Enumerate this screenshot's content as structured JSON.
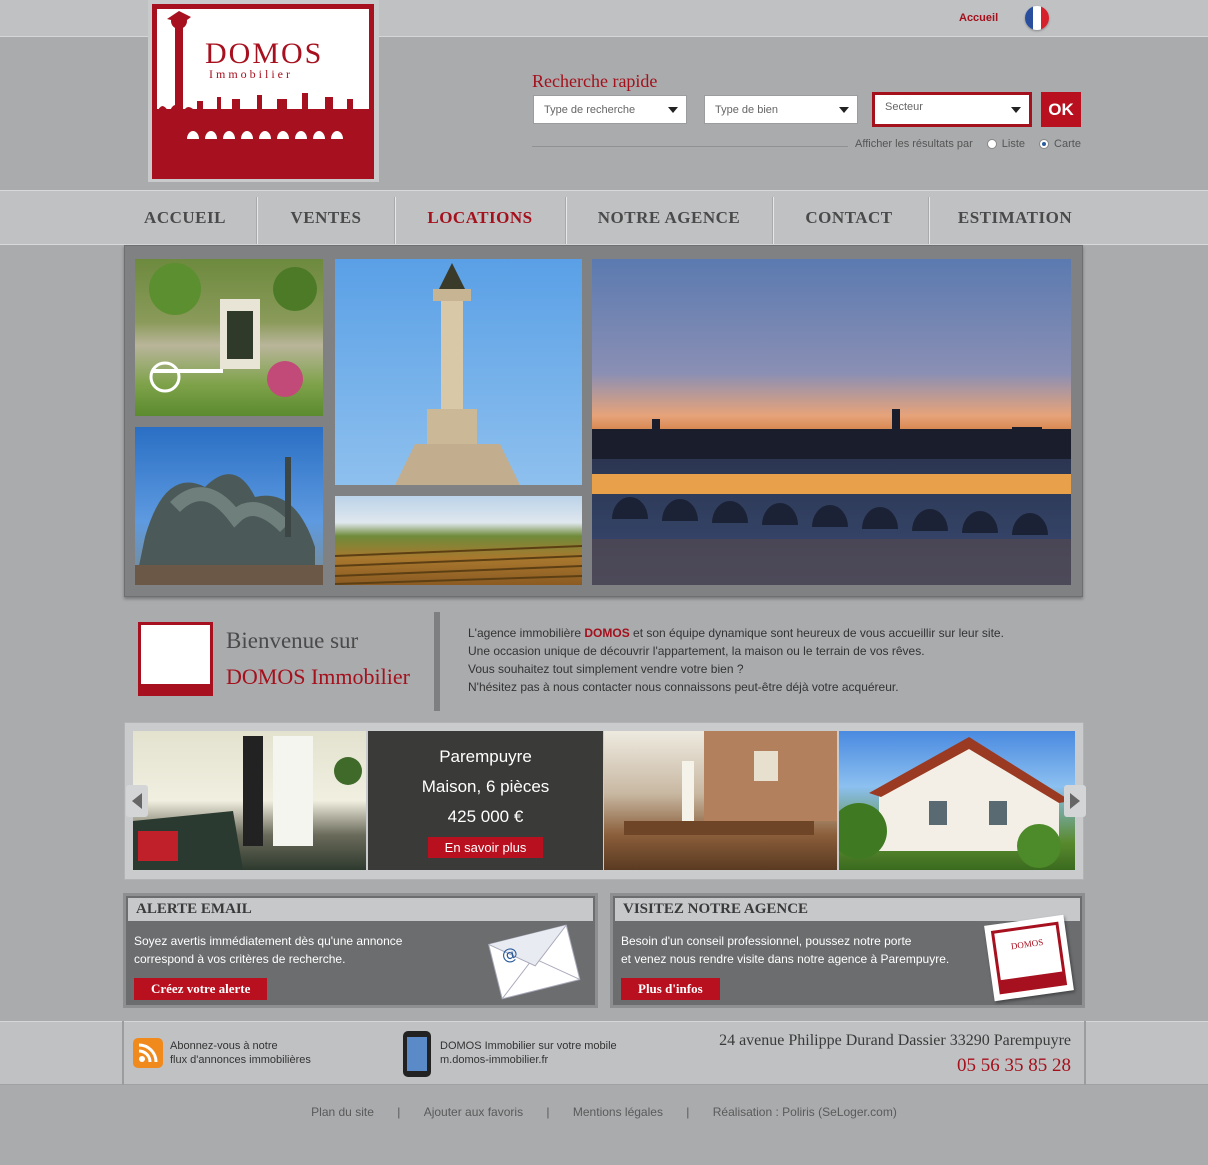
{
  "top": {
    "accueil": "Accueil",
    "lang_icon": "french-flag-icon"
  },
  "logo": {
    "title": "DOMOS",
    "subtitle": "Immobilier"
  },
  "search": {
    "title": "Recherche rapide",
    "type_recherche": "Type de recherche",
    "type_bien": "Type de bien",
    "secteur": "Secteur",
    "ok": "OK",
    "display_label": "Afficher les résultats par",
    "opt_list": "Liste",
    "opt_map": "Carte",
    "selected": "Carte"
  },
  "nav": [
    "ACCUEIL",
    "VENTES",
    "LOCATIONS",
    "NOTRE AGENCE",
    "CONTACT",
    "ESTIMATION"
  ],
  "nav_active": "LOCATIONS",
  "welcome": {
    "line1": "Bienvenue sur",
    "line2": "DOMOS Immobilier",
    "p1_before": "L'agence immobilière ",
    "p1_brand": "DOMOS",
    "p1_after": " et son équipe dynamique sont heureux de vous accueillir sur leur site.",
    "p2": "Une occasion unique de découvrir l'appartement, la maison ou le terrain de vos rêves.",
    "p3": "Vous souhaitez tout simplement vendre votre bien ?",
    "p4": "N'hésitez pas à nous contacter nous connaissons peut-être déjà votre acquéreur."
  },
  "carousel": {
    "city": "Parempuyre",
    "type": "Maison, 6 pièces",
    "price": "425 000 €",
    "button": "En savoir plus"
  },
  "alert_box": {
    "title": "ALERTE EMAIL",
    "text1": "Soyez avertis immédiatement dès qu'une annonce",
    "text2": "correspond à vos critères de recherche.",
    "button": "Créez votre alerte"
  },
  "agency_box": {
    "title": "VISITEZ NOTRE AGENCE",
    "text1": "Besoin d'un conseil professionnel, poussez notre porte",
    "text2": "et venez nous rendre visite dans notre agence à Parempuyre.",
    "button": "Plus d'infos",
    "card_text": "DOMOS"
  },
  "footer": {
    "rss1": "Abonnez-vous à notre",
    "rss2": "flux d'annonces immobilières",
    "mobile1": "DOMOS Immobilier sur votre mobile",
    "mobile2": "m.domos-immobilier.fr",
    "address": "24 avenue Philippe Durand Dassier 33290 Parempuyre",
    "phone": "05 56 35 85 28",
    "links": [
      "Plan du site",
      "Ajouter aux favoris",
      "Mentions légales",
      "Réalisation : Poliris (SeLoger.com)"
    ],
    "sep": "|"
  },
  "colors": {
    "brand_red": "#a4101c",
    "background": "#a9abad",
    "band": "#bfc1c3"
  }
}
